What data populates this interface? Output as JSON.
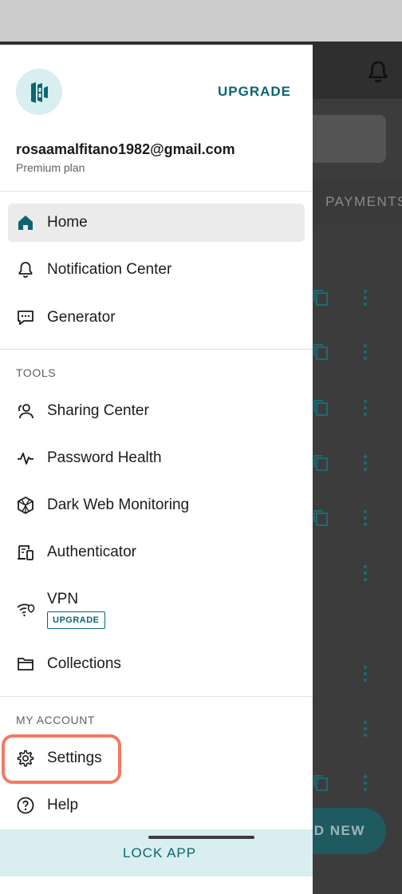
{
  "drawer": {
    "upgrade_link": "UPGRADE",
    "email": "rosaamalfitano1982@gmail.com",
    "plan": "Premium plan",
    "items": {
      "home": "Home",
      "notification_center": "Notification Center",
      "generator": "Generator",
      "sharing_center": "Sharing Center",
      "password_health": "Password Health",
      "dark_web_monitoring": "Dark Web Monitoring",
      "authenticator": "Authenticator",
      "vpn": "VPN",
      "vpn_badge": "UPGRADE",
      "collections": "Collections",
      "settings": "Settings",
      "help": "Help"
    },
    "sections": {
      "tools": "TOOLS",
      "my_account": "MY ACCOUNT"
    },
    "lock_app": "LOCK APP"
  },
  "background": {
    "tab_payments": "PAYMENTS",
    "add_new": "DD NEW"
  },
  "colors": {
    "accent": "#0c6571",
    "accent_light": "#d8eef0",
    "highlight": "#f27a61"
  },
  "icons": {
    "home": "home-icon",
    "notification_center": "bell-icon",
    "generator": "message-icon",
    "sharing_center": "users-icon",
    "password_health": "pulse-icon",
    "dark_web_monitoring": "shield-web-icon",
    "authenticator": "authenticator-icon",
    "vpn": "wifi-lock-icon",
    "collections": "folder-icon",
    "settings": "gear-icon",
    "help": "question-icon"
  }
}
